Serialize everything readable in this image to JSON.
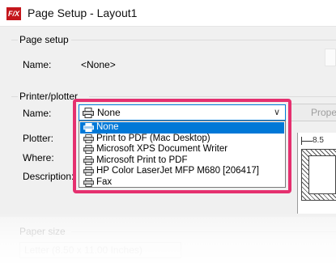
{
  "window": {
    "title": "Page Setup - Layout1",
    "app_icon_text": "F/X",
    "app_icon_color": "#c4161c"
  },
  "page_setup": {
    "group_label": "Page setup",
    "name_label": "Name:",
    "name_value": "<None>"
  },
  "printer": {
    "group_label": "Printer/plotter",
    "name_label": "Name:",
    "selected": "None",
    "properties_button": "Prope",
    "plotter_label": "Plotter:",
    "where_label": "Where:",
    "description_label": "Description:",
    "options": [
      {
        "label": "None",
        "icon": "printer-icon",
        "selected": true
      },
      {
        "label": "Print to PDF (Mac Desktop)",
        "icon": "printer-icon",
        "selected": false
      },
      {
        "label": "Microsoft XPS Document Writer",
        "icon": "printer-icon",
        "selected": false
      },
      {
        "label": "Microsoft Print to PDF",
        "icon": "printer-icon",
        "selected": false
      },
      {
        "label": "HP Color LaserJet MFP M680 [206417]",
        "icon": "printer-icon",
        "selected": false
      },
      {
        "label": "Fax",
        "icon": "printer-icon",
        "selected": false
      }
    ]
  },
  "preview": {
    "dimension_text": "8.5"
  },
  "paper": {
    "group_label": "Paper size",
    "value": "Letter (8.50 x 11.00 Inches)"
  },
  "colors": {
    "highlight": "#e5306f",
    "selection": "#0078d7"
  }
}
